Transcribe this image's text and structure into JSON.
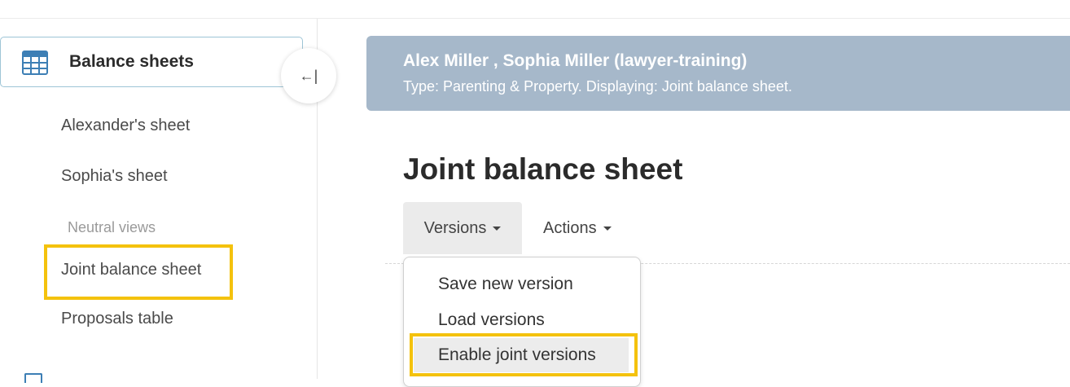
{
  "sidebar": {
    "header_title": "Balance sheets",
    "collapse_icon": "collapse-left-icon",
    "items": [
      {
        "label": "Alexander's sheet"
      },
      {
        "label": "Sophia's sheet"
      },
      {
        "label": "Joint balance sheet"
      },
      {
        "label": "Proposals table"
      }
    ],
    "section_label": "Neutral views",
    "collapse_symbol": "←|"
  },
  "banner": {
    "title": "Alex Miller , Sophia Miller (lawyer-training)",
    "subtitle": "Type: Parenting & Property. Displaying: Joint balance sheet."
  },
  "main": {
    "page_title": "Joint balance sheet",
    "tabs": [
      {
        "label": "Versions"
      },
      {
        "label": "Actions"
      }
    ]
  },
  "dropdown": {
    "items": [
      {
        "label": "Save new version"
      },
      {
        "label": "Load versions"
      },
      {
        "label": "Enable joint versions"
      }
    ]
  },
  "colors": {
    "banner_bg": "#a6b8ca",
    "highlight": "#f4c20d",
    "accent_blue": "#3d7fb5"
  }
}
